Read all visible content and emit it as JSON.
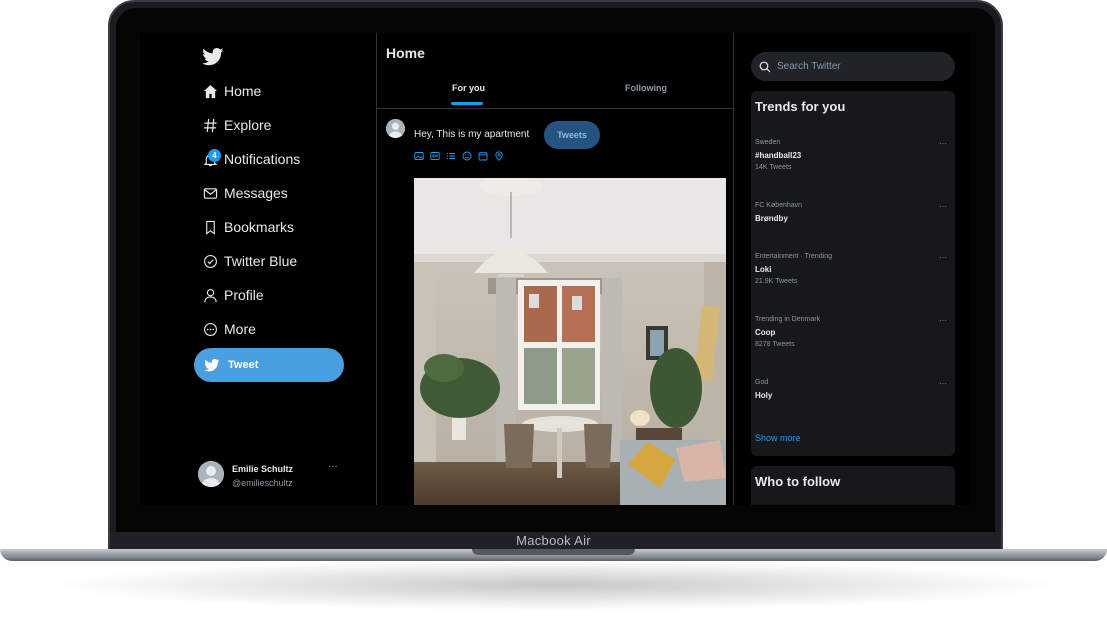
{
  "device": {
    "label": "Macbook Air"
  },
  "nav": {
    "items": [
      {
        "label": "Home",
        "icon": "home-icon"
      },
      {
        "label": "Explore",
        "icon": "hashtag-icon"
      },
      {
        "label": "Notifications",
        "icon": "bell-icon",
        "badge": "4"
      },
      {
        "label": "Messages",
        "icon": "envelope-icon"
      },
      {
        "label": "Bookmarks",
        "icon": "bookmark-icon"
      },
      {
        "label": "Twitter Blue",
        "icon": "verified-icon"
      },
      {
        "label": "Profile",
        "icon": "person-icon"
      },
      {
        "label": "More",
        "icon": "more-circle-icon"
      }
    ],
    "tweet_button": "Tweet",
    "user": {
      "name": "Emilie Schultz",
      "handle": "@emilieschultz",
      "more": "···"
    }
  },
  "main": {
    "title": "Home",
    "tabs": [
      {
        "label": "For you",
        "active": true
      },
      {
        "label": "Following",
        "active": false
      }
    ],
    "compose": {
      "text": "Hey, This is my apartment",
      "button": "Tweets"
    },
    "tools": [
      "image-icon",
      "gif-icon",
      "poll-icon",
      "emoji-icon",
      "schedule-icon",
      "location-icon"
    ]
  },
  "right": {
    "search_placeholder": "Search Twitter",
    "trends_title": "Trends for you",
    "trends": [
      {
        "context": "Sweden",
        "name": "#handball23",
        "count": "14K Tweets"
      },
      {
        "context": "FC København",
        "name": "Brøndby",
        "count": ""
      },
      {
        "context": "Entertainment · Trending",
        "name": "Loki",
        "count": "21.9K Tweets"
      },
      {
        "context": "Trending in Denmark",
        "name": "Coop",
        "count": "8278 Tweets"
      },
      {
        "context": "God",
        "name": "Holy",
        "count": ""
      }
    ],
    "trend_more": "···",
    "show_more": "Show more",
    "who_to_follow": "Who to follow"
  },
  "colors": {
    "accent": "#1d9bf0",
    "background": "#000000",
    "panel": "#16181c",
    "text": "#e7e9ea",
    "muted": "#8b98a5"
  }
}
